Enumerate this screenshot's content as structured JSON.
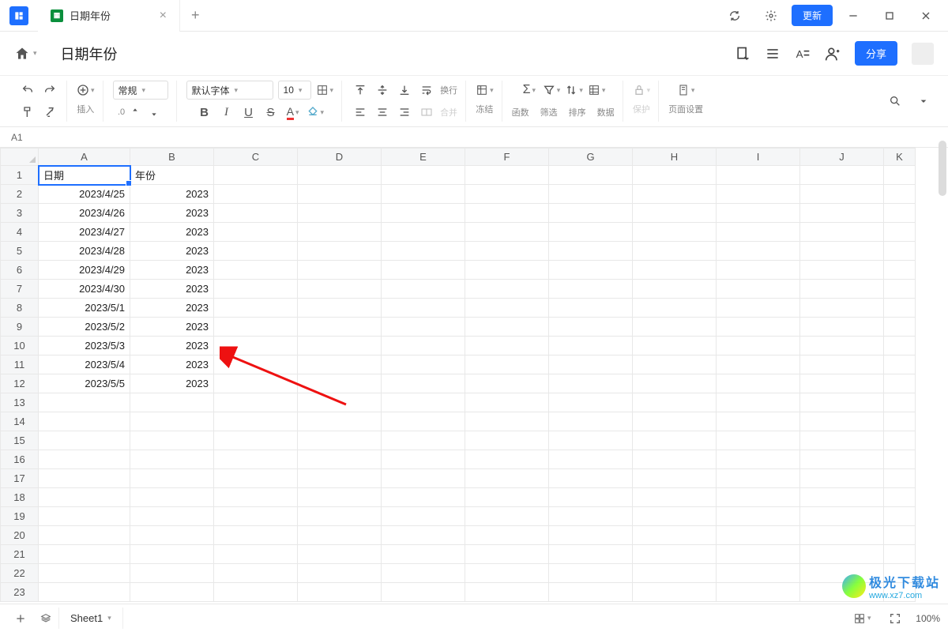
{
  "titlebar": {
    "tab_label": "日期年份",
    "update_label": "更新"
  },
  "docbar": {
    "doc_title": "日期年份",
    "share_label": "分享"
  },
  "toolbar": {
    "insert_label": "插入",
    "format_select": "常规",
    "decimal_label": ".0",
    "font_select": "默认字体",
    "fontsize_select": "10",
    "wrap_label": "换行",
    "merge_label": "合并",
    "freeze_label": "冻结",
    "func_label": "函数",
    "filter_label": "筛选",
    "sort_label": "排序",
    "data_label": "数据",
    "protect_label": "保护",
    "page_label": "页面设置"
  },
  "cellref": "A1",
  "columns": [
    "A",
    "B",
    "C",
    "D",
    "E",
    "F",
    "G",
    "H",
    "I",
    "J",
    "K"
  ],
  "rows": [
    1,
    2,
    3,
    4,
    5,
    6,
    7,
    8,
    9,
    10,
    11,
    12,
    13,
    14,
    15,
    16,
    17,
    18,
    19,
    20,
    21,
    22,
    23
  ],
  "data": {
    "A": [
      "日期",
      "2023/4/25",
      "2023/4/26",
      "2023/4/27",
      "2023/4/28",
      "2023/4/29",
      "2023/4/30",
      "2023/5/1",
      "2023/5/2",
      "2023/5/3",
      "2023/5/4",
      "2023/5/5"
    ],
    "B": [
      "年份",
      "2023",
      "2023",
      "2023",
      "2023",
      "2023",
      "2023",
      "2023",
      "2023",
      "2023",
      "2023",
      "2023"
    ]
  },
  "col_widths": {
    "A": 116,
    "B": 106,
    "other": 106,
    "K": 40
  },
  "statusbar": {
    "sheet_tab": "Sheet1",
    "zoom": "100%"
  },
  "watermark": {
    "text1": "极光下载站",
    "text2": "www.xz7.com"
  }
}
